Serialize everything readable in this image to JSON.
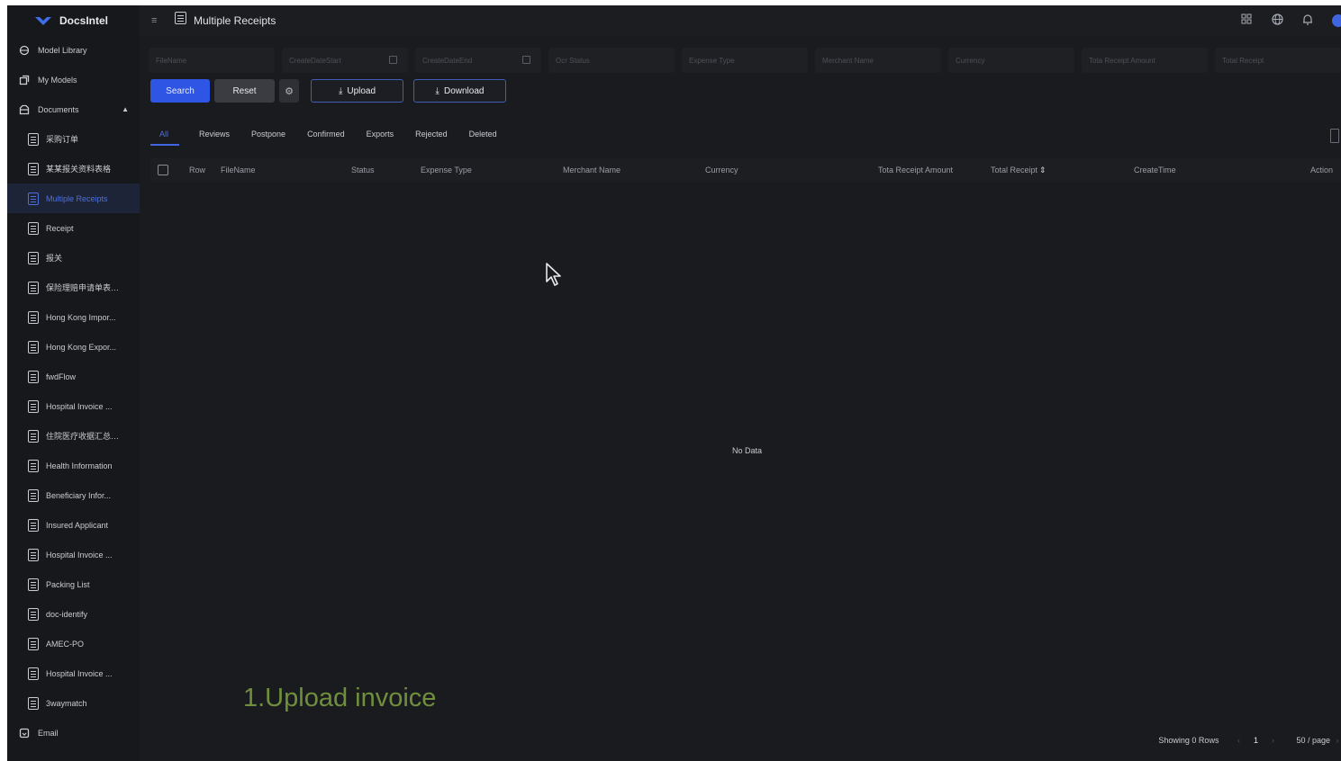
{
  "app": {
    "name": "DocsIntel"
  },
  "sidebar": {
    "top_items": [
      {
        "label": "Model Library",
        "icon": "model-library-icon"
      },
      {
        "label": "My Models",
        "icon": "my-models-icon"
      },
      {
        "label": "Documents",
        "icon": "documents-icon"
      }
    ],
    "documents": [
      "采购订单",
      "某某报关资料表格",
      "Multiple Receipts",
      "Receipt",
      "报关",
      "保险理赔申请单表格...",
      "Hong Kong Impor...",
      "Hong Kong Expor...",
      "fwdFlow",
      "Hospital Invoice ...",
      "住院医疗收据汇总表...",
      "Health Information",
      "Beneficiary Infor...",
      "Insured Applicant",
      "Hospital Invoice ...",
      "Packing List",
      "doc-identify",
      "AMEC-PO",
      "Hospital Invoice ...",
      "3waymatch"
    ],
    "active_document": "Multiple Receipts",
    "bottom_item": {
      "label": "Email",
      "icon": "email-icon"
    }
  },
  "header": {
    "title": "Multiple Receipts",
    "icons": [
      "apps-grid-icon",
      "globe-icon",
      "bell-icon",
      "avatar"
    ]
  },
  "filters": [
    {
      "placeholder": "FileName"
    },
    {
      "placeholder": "CreateDateStart",
      "calendar": true
    },
    {
      "placeholder": "CreateDateEnd",
      "calendar": true
    },
    {
      "placeholder": "Ocr Status"
    },
    {
      "placeholder": "Expense Type"
    },
    {
      "placeholder": "Merchant Name"
    },
    {
      "placeholder": "Currency"
    },
    {
      "placeholder": "Tota Receipt Amount"
    },
    {
      "placeholder": "Total Receipt"
    }
  ],
  "toolbar": {
    "search_label": "Search",
    "reset_label": "Reset",
    "upload_label": "Upload",
    "download_label": "Download"
  },
  "tabs": [
    "All",
    "Reviews",
    "Postpone",
    "Confirmed",
    "Exports",
    "Rejected",
    "Deleted"
  ],
  "active_tab": "All",
  "table": {
    "columns": [
      "Row",
      "FileName",
      "Status",
      "Expense Type",
      "Merchant Name",
      "Currency",
      "Tota Receipt Amount",
      "Total Receipt",
      "CreateTime",
      "Action"
    ],
    "sortable_column": "Total Receipt",
    "rows": [],
    "empty_text": "No Data"
  },
  "pagination": {
    "summary": "Showing 0 Rows",
    "current_page": "1",
    "page_size": "50 / page"
  },
  "caption": "1.Upload invoice",
  "colors": {
    "primary": "#2f55e4",
    "background": "#1a1b1f",
    "sidebar": "#17181b",
    "active_text": "#4e6fd6",
    "caption": "#6f8f3c"
  }
}
